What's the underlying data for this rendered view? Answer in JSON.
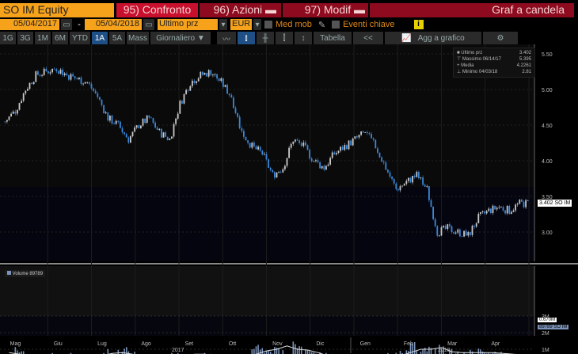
{
  "header": {
    "ticker": "SO IM Equity",
    "confronto": "95) Confronto",
    "azioni": "96) Azioni",
    "modif": "97) Modif",
    "title": "Graf a candela"
  },
  "controls": {
    "start_date": "05/04/2017",
    "sep": "-",
    "end_date": "05/04/2018",
    "field": "Ultimo prz",
    "currency": "EUR",
    "med_mob": "Med mob",
    "eventi": "Eventi chiave",
    "info": "i"
  },
  "periods": [
    "1G",
    "3G",
    "1M",
    "6M",
    "YTD",
    "1A",
    "5A",
    "Mass"
  ],
  "active_period": "1A",
  "frequency": "Giornaliero ▼",
  "toolbar": {
    "tabella": "Tabella",
    "collapse": "<<",
    "add": "Agg a grafico"
  },
  "legend": {
    "rows": [
      {
        "label": "Ultimo prz",
        "value": "3.402"
      },
      {
        "label": "Massimo 06/14/17",
        "value": "5.395"
      },
      {
        "label": "Media",
        "value": "4.2261"
      },
      {
        "label": "Minimo 04/03/18",
        "value": "2.81"
      }
    ]
  },
  "last_price_tag": "3.402 SO IM",
  "volume": {
    "legend": "Volume 89789",
    "ma_tag": "0.670M",
    "last_tag": "89789 SO IM"
  },
  "colors": {
    "up": "#c8c8c8",
    "down": "#3a86d8",
    "vol": "#7b93b8"
  },
  "chart_data": {
    "type": "candlestick",
    "price_ticks": [
      "5.50",
      "5.00",
      "4.50",
      "4.00",
      "3.50",
      "3.00"
    ],
    "ylim": [
      2.6,
      5.6
    ],
    "weekly_close": [
      4.55,
      4.7,
      5.0,
      5.2,
      5.25,
      5.3,
      5.2,
      5.15,
      5.1,
      4.9,
      4.6,
      4.5,
      4.3,
      4.5,
      4.6,
      4.4,
      4.3,
      4.8,
      5.1,
      5.2,
      5.25,
      5.1,
      4.9,
      4.4,
      4.2,
      4.1,
      3.8,
      3.9,
      4.3,
      4.2,
      4.0,
      3.9,
      4.1,
      4.2,
      4.3,
      4.4,
      4.2,
      3.9,
      3.6,
      3.7,
      3.8,
      3.6,
      3.0,
      3.05,
      3.0,
      2.95,
      3.2,
      3.3,
      3.35,
      3.3,
      3.4
    ],
    "volume_ticks": [
      "3M",
      "2M",
      "1M"
    ],
    "weekly_volume_m": [
      0.5,
      0.9,
      0.6,
      0.5,
      0.6,
      0.5,
      0.6,
      0.5,
      0.4,
      0.6,
      0.8,
      0.9,
      0.7,
      0.5,
      0.4,
      0.5,
      0.6,
      0.5,
      0.6,
      0.7,
      0.6,
      0.5,
      0.4,
      0.4,
      1.2,
      0.9,
      1.0,
      0.9,
      1.3,
      0.8,
      0.7,
      0.6,
      0.5,
      0.5,
      0.4,
      0.5,
      0.6,
      0.6,
      0.7,
      1.2,
      0.9,
      0.9,
      1.0,
      0.8,
      0.7,
      0.8,
      0.9,
      0.8,
      0.7,
      0.6,
      0.3
    ],
    "volume_ma_m": [
      0.8,
      0.7,
      0.65,
      0.6,
      0.6,
      0.6,
      0.55,
      0.5,
      0.5,
      0.6,
      0.75,
      0.8,
      0.7,
      0.6,
      0.5,
      0.5,
      0.55,
      0.6,
      0.7,
      0.7,
      0.65,
      0.6,
      0.5,
      0.4,
      0.7,
      0.9,
      1.0,
      1.2,
      1.0,
      0.95,
      0.8,
      0.6,
      0.5,
      0.45,
      0.45,
      0.5,
      0.55,
      0.6,
      0.6,
      0.8,
      1.0,
      1.0,
      1.1,
      0.85,
      0.8,
      0.8,
      0.8,
      0.8,
      0.75,
      0.7,
      0.67
    ],
    "months": [
      "Mag",
      "Giu",
      "Lug",
      "Ago",
      "Set",
      "Ott",
      "Nov",
      "Dic",
      "Gen",
      "Feb",
      "Mar",
      "Apr"
    ],
    "years": [
      "2017",
      "2018"
    ]
  }
}
